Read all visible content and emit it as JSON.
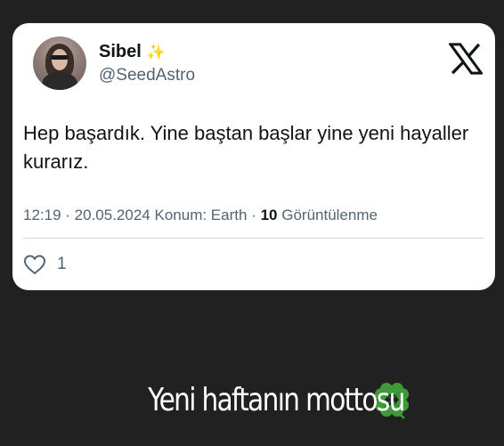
{
  "tweet": {
    "author": {
      "name": "Sibel",
      "name_emoji": "✨",
      "handle": "@SeedAstro",
      "avatar_icon": "profile-photo"
    },
    "platform_icon": "x-logo-icon",
    "text": "Hep başardık. Yine baştan başlar yine yeni hayaller kurarız.",
    "time": "12:19",
    "date": "20.05.2024",
    "location": "Konum: Earth",
    "views_count": "10",
    "views_label": "Görüntülenme",
    "like_count": "1",
    "like_icon": "heart-outline-icon"
  },
  "caption": {
    "text": "Yeni haftanın mottosu",
    "emoji": "🍀",
    "emoji_icon": "four-leaf-clover-icon"
  },
  "colors": {
    "background": "#212121",
    "card": "#ffffff",
    "primary_text": "#0f1419",
    "secondary_text": "#536471",
    "sparkle": "#f4c542",
    "clover_green": "#3f9b3a"
  }
}
